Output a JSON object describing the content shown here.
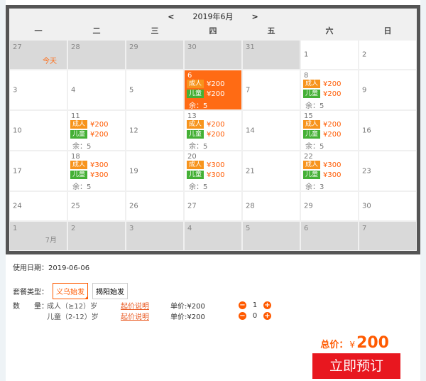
{
  "calendar": {
    "prev": "<",
    "next": ">",
    "month_title": "2019年6月",
    "weekdays": [
      "一",
      "二",
      "三",
      "四",
      "五",
      "六",
      "日"
    ],
    "today_label": "今天",
    "july_label": "7月",
    "adult_tag": "成人",
    "child_tag": "儿童",
    "remain_prefix": "余：",
    "weeks": [
      [
        {
          "d": "27",
          "other": true,
          "today": true
        },
        {
          "d": "28",
          "other": true
        },
        {
          "d": "29",
          "other": true
        },
        {
          "d": "30",
          "other": true
        },
        {
          "d": "31",
          "other": true
        },
        {
          "d": "1"
        },
        {
          "d": "2"
        }
      ],
      [
        {
          "d": "3"
        },
        {
          "d": "4"
        },
        {
          "d": "5"
        },
        {
          "d": "6",
          "selected": true,
          "adult": "¥200",
          "child": "¥200",
          "remain": "5"
        },
        {
          "d": "7"
        },
        {
          "d": "8",
          "adult": "¥200",
          "child": "¥200",
          "remain": "5"
        },
        {
          "d": "9"
        }
      ],
      [
        {
          "d": "10"
        },
        {
          "d": "11",
          "adult": "¥200",
          "child": "¥200",
          "remain": "5"
        },
        {
          "d": "12"
        },
        {
          "d": "13",
          "adult": "¥200",
          "child": "¥200",
          "remain": "5"
        },
        {
          "d": "14"
        },
        {
          "d": "15",
          "adult": "¥200",
          "child": "¥200",
          "remain": "5"
        },
        {
          "d": "16"
        }
      ],
      [
        {
          "d": "17"
        },
        {
          "d": "18",
          "adult": "¥300",
          "child": "¥300",
          "remain": "5"
        },
        {
          "d": "19"
        },
        {
          "d": "20",
          "adult": "¥300",
          "child": "¥300",
          "remain": "5"
        },
        {
          "d": "21"
        },
        {
          "d": "22",
          "adult": "¥300",
          "child": "¥300",
          "remain": "3"
        },
        {
          "d": "23"
        }
      ],
      [
        {
          "d": "24"
        },
        {
          "d": "25"
        },
        {
          "d": "26"
        },
        {
          "d": "27"
        },
        {
          "d": "28"
        },
        {
          "d": "29"
        },
        {
          "d": "30"
        }
      ],
      [
        {
          "d": "1",
          "other": true,
          "july": true
        },
        {
          "d": "2",
          "other": true
        },
        {
          "d": "3",
          "other": true
        },
        {
          "d": "4",
          "other": true
        },
        {
          "d": "5",
          "other": true
        },
        {
          "d": "6",
          "other": true
        },
        {
          "d": "7",
          "other": true
        }
      ]
    ]
  },
  "booking": {
    "use_date_label": "使用日期：",
    "use_date": "2019-06-06",
    "package_label": "套餐类型：",
    "packages": [
      "义乌始发",
      "揭阳始发"
    ],
    "quantity_label": "数　　量：",
    "rows": [
      {
        "name": "成人（≥12）岁",
        "explain": "起价说明",
        "unit": "单价:¥200",
        "qty": "1"
      },
      {
        "name": "儿童（2-12）岁",
        "explain": "起价说明",
        "unit": "单价:¥200",
        "qty": "0"
      }
    ],
    "minus": "−",
    "plus": "+",
    "total_label": "总价：",
    "currency": "¥",
    "total": "200",
    "book_label": "立即预订"
  },
  "colors": {
    "accent": "#ff6b14",
    "adult_tag": "#f7941d",
    "child_tag": "#44b035",
    "book_button": "#e8171f"
  }
}
